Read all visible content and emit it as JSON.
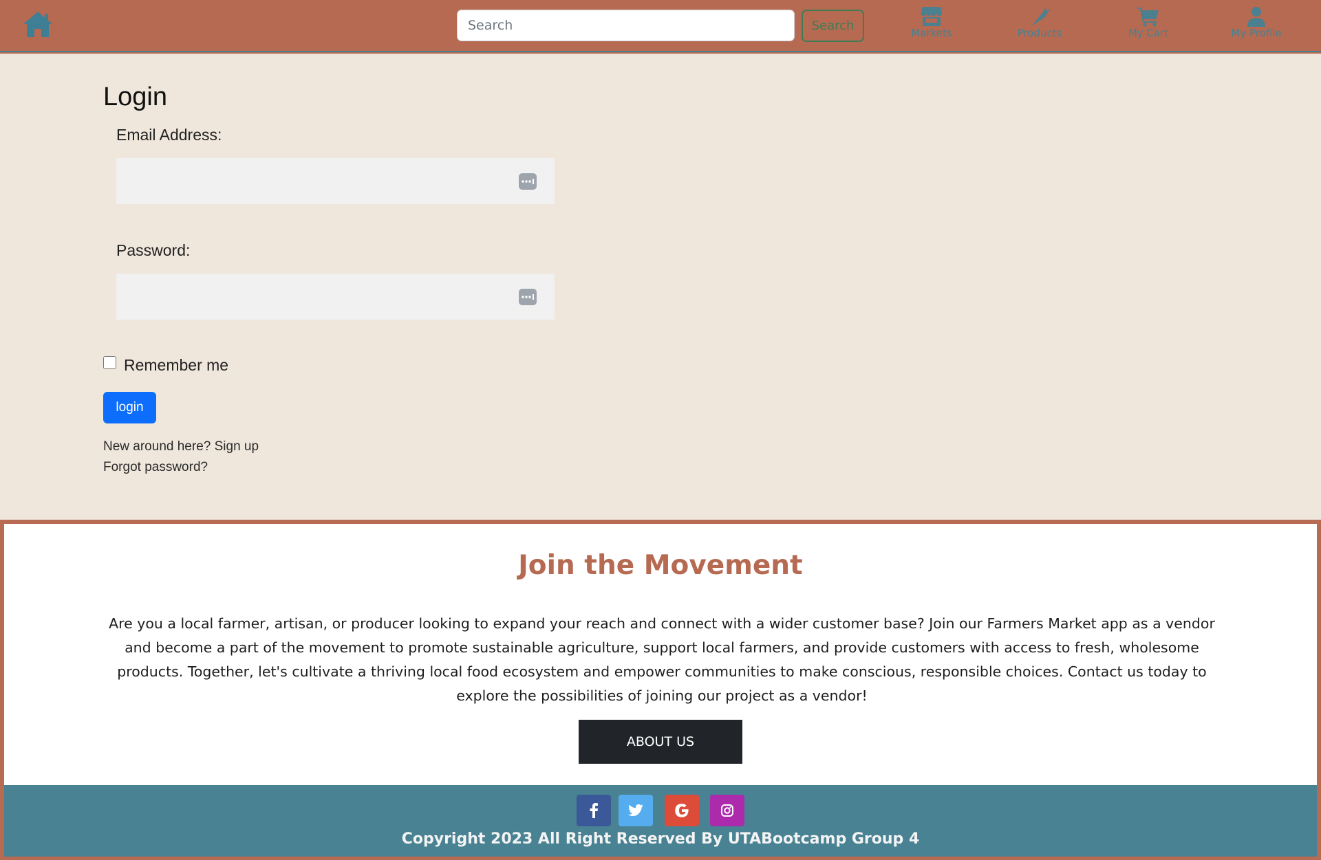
{
  "navbar": {
    "home_icon": "home-icon",
    "search_placeholder": "Search",
    "search_value": "",
    "search_button_label": "Search",
    "items": [
      {
        "label": "Markets",
        "icon": "store-icon"
      },
      {
        "label": "Products",
        "icon": "carrot-icon"
      },
      {
        "label": "My Cart",
        "icon": "cart-icon"
      },
      {
        "label": "My Profile",
        "icon": "user-icon"
      }
    ]
  },
  "login": {
    "title": "Login",
    "email_label": "Email Address:",
    "email_value": "",
    "password_label": "Password:",
    "password_value": "",
    "remember_label": "Remember me",
    "remember_checked": false,
    "submit_label": "login",
    "signup_link": "New around here? Sign up",
    "forgot_link": "Forgot password?"
  },
  "join": {
    "title": "Join the Movement",
    "text": "Are you a local farmer, artisan, or producer looking to expand your reach and connect with a wider customer base? Join our Farmers Market app as a vendor and become a part of the movement to promote sustainable agriculture, support local farmers, and provide customers with access to fresh, wholesome products. Together, let's cultivate a thriving local food ecosystem and empower communities to make conscious, responsible choices. Contact us today to explore the possibilities of joining our project as a vendor!",
    "button_label": "ABOUT US"
  },
  "footer": {
    "social": [
      {
        "name": "facebook-icon",
        "color": "#3b5998"
      },
      {
        "name": "twitter-icon",
        "color": "#55acee"
      },
      {
        "name": "google-icon",
        "color": "#dd4b39"
      },
      {
        "name": "instagram-icon",
        "color": "#ac2bac"
      }
    ],
    "copyright": "Copyright 2023 All Right Reserved By UTABootcamp Group 4"
  },
  "colors": {
    "navbar_bg": "#b56a51",
    "accent_teal": "#4a8090",
    "main_bg": "#efe7dc",
    "join_title": "#b56a51",
    "login_button": "#0d6efd",
    "about_button": "#212529",
    "footer_bg": "#488293"
  }
}
